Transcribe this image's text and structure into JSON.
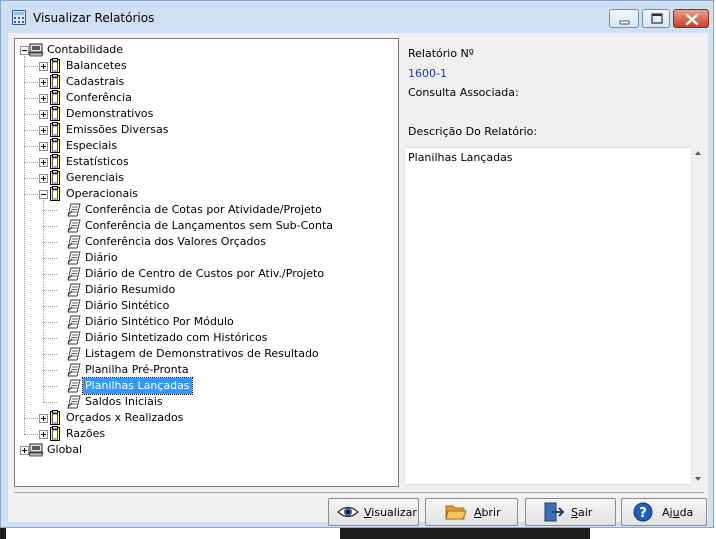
{
  "window": {
    "title": "Visualizar Relatórios"
  },
  "tree": {
    "nodes": [
      {
        "label": "Contabilidade",
        "level": 0,
        "icon": "computer-icon",
        "expander": "minus"
      },
      {
        "label": "Balancetes",
        "level": 1,
        "icon": "folder-icon",
        "expander": "plus"
      },
      {
        "label": "Cadastrais",
        "level": 1,
        "icon": "folder-icon",
        "expander": "plus"
      },
      {
        "label": "Conferência",
        "level": 1,
        "icon": "folder-icon",
        "expander": "plus"
      },
      {
        "label": "Demonstrativos",
        "level": 1,
        "icon": "folder-icon",
        "expander": "plus"
      },
      {
        "label": "Emissões Diversas",
        "level": 1,
        "icon": "folder-icon",
        "expander": "plus"
      },
      {
        "label": "Especiais",
        "level": 1,
        "icon": "folder-icon",
        "expander": "plus"
      },
      {
        "label": "Estatísticos",
        "level": 1,
        "icon": "folder-icon",
        "expander": "plus"
      },
      {
        "label": "Gerenciais",
        "level": 1,
        "icon": "folder-icon",
        "expander": "plus"
      },
      {
        "label": "Operacionais",
        "level": 1,
        "icon": "folder-icon",
        "expander": "minus"
      },
      {
        "label": "Conferência de Cotas por Atividade/Projeto",
        "level": 2,
        "icon": "report-icon"
      },
      {
        "label": "Conferência de Lançamentos sem Sub-Conta",
        "level": 2,
        "icon": "report-icon"
      },
      {
        "label": "Conferência dos Valores Orçados",
        "level": 2,
        "icon": "report-icon"
      },
      {
        "label": "Diário",
        "level": 2,
        "icon": "report-icon"
      },
      {
        "label": "Diário de Centro de Custos por Ativ./Projeto",
        "level": 2,
        "icon": "report-icon"
      },
      {
        "label": "Diário Resumido",
        "level": 2,
        "icon": "report-icon"
      },
      {
        "label": "Diário Sintético",
        "level": 2,
        "icon": "report-icon"
      },
      {
        "label": "Diário Sintético Por Módulo",
        "level": 2,
        "icon": "report-icon"
      },
      {
        "label": "Diário Sintetizado com Históricos",
        "level": 2,
        "icon": "report-icon"
      },
      {
        "label": "Listagem de Demonstrativos de Resultado",
        "level": 2,
        "icon": "report-icon"
      },
      {
        "label": "Planilha Pré-Pronta",
        "level": 2,
        "icon": "report-icon"
      },
      {
        "label": "Planilhas Lançadas",
        "level": 2,
        "icon": "report-icon",
        "selected": true
      },
      {
        "label": "Saldos Iniciais",
        "level": 2,
        "icon": "report-icon"
      },
      {
        "label": "Orçados x Realizados",
        "level": 1,
        "icon": "folder-icon",
        "expander": "plus"
      },
      {
        "label": "Razões",
        "level": 1,
        "icon": "folder-icon",
        "expander": "plus"
      },
      {
        "label": "Global",
        "level": 0,
        "icon": "computer-icon",
        "expander": "plus"
      }
    ]
  },
  "info": {
    "report_number_label": "Relatório Nº",
    "report_number": "1600-1",
    "query_label": "Consulta Associada:",
    "description_label": "Descrição Do Relatório:",
    "description_text": "Planilhas Lançadas"
  },
  "buttons": {
    "visualizar": {
      "pre": "",
      "key": "V",
      "post": "isualizar",
      "icon": "eye-icon"
    },
    "abrir": {
      "pre": "",
      "key": "A",
      "post": "brir",
      "icon": "folder-open-icon"
    },
    "sair": {
      "pre": "",
      "key": "S",
      "post": "air",
      "icon": "exit-icon"
    },
    "ajuda": {
      "pre": "Aj",
      "key": "u",
      "post": "da",
      "icon": "help-icon"
    }
  },
  "colors": {
    "selection": "#3399ff",
    "accent_text": "#1a3ca8",
    "window_frame": "#cfe0f3"
  }
}
